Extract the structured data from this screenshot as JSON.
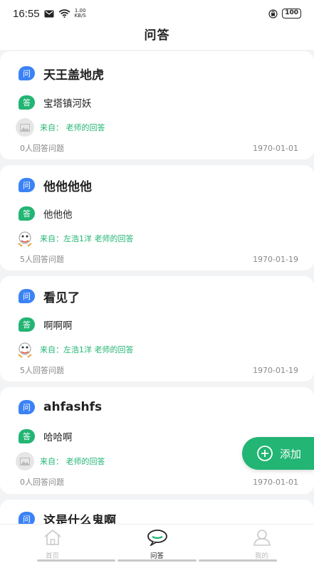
{
  "status": {
    "time": "16:55",
    "speed_top": "1.00",
    "speed_bottom": "KB/S",
    "battery": "100"
  },
  "header": {
    "title": "问答"
  },
  "badges": {
    "question": "问",
    "answer": "答"
  },
  "items": [
    {
      "question": "天王盖地虎",
      "answer": "宝塔镇河妖",
      "from": "来自： 老师的回答",
      "avatar": "placeholder-image-icon",
      "count": "0人回答问题",
      "date": "1970-01-01"
    },
    {
      "question": "他他他他",
      "answer": "他他他",
      "from": "来自：左浩1洋 老师的回答",
      "avatar": "cartoon-avatar",
      "count": "5人回答问题",
      "date": "1970-01-19"
    },
    {
      "question": "看见了",
      "answer": "啊啊啊",
      "from": "来自：左浩1洋 老师的回答",
      "avatar": "cartoon-avatar",
      "count": "5人回答问题",
      "date": "1970-01-19"
    },
    {
      "question": "ahfashfs",
      "answer": "哈哈啊",
      "from": "来自： 老师的回答",
      "avatar": "placeholder-image-icon",
      "count": "0人回答问题",
      "date": "1970-01-01"
    },
    {
      "question": "这是什么鬼啊"
    }
  ],
  "add_button": {
    "label": "添加"
  },
  "tabs": [
    {
      "label": "首页",
      "icon": "home-icon",
      "active": false
    },
    {
      "label": "问答",
      "icon": "chat-bubble-icon",
      "active": true
    },
    {
      "label": "我的",
      "icon": "user-icon",
      "active": false
    }
  ]
}
